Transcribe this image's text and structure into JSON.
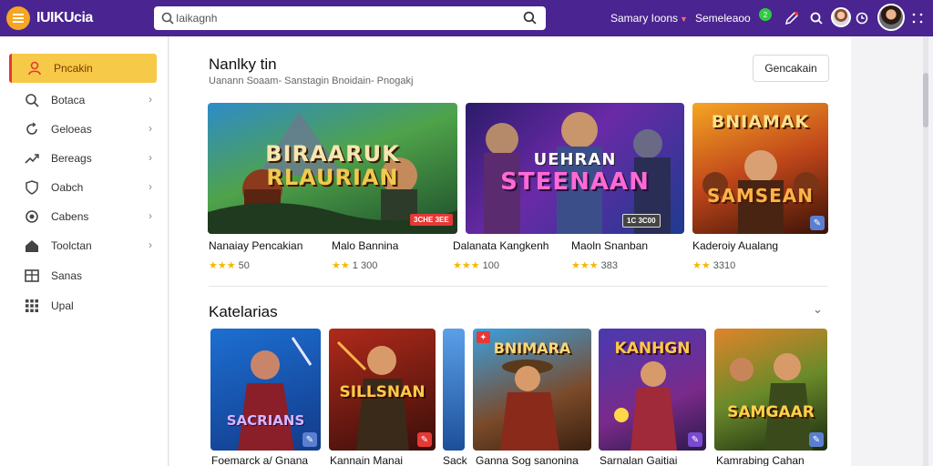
{
  "header": {
    "logo_text": "IUIKUciа",
    "search_value": "Iaikagnh",
    "link_1": "Samary Ioons",
    "link_2": "Semeleaoo",
    "notif_count": "2"
  },
  "sidebar": {
    "items": [
      {
        "label": "Pncakin",
        "icon": "user-icon",
        "active": true,
        "chevron": false
      },
      {
        "label": "Botaca",
        "icon": "search-icon",
        "active": false,
        "chevron": true
      },
      {
        "label": "Geloeas",
        "icon": "refresh-icon",
        "active": false,
        "chevron": true
      },
      {
        "label": "Bereags",
        "icon": "trend-icon",
        "active": false,
        "chevron": true
      },
      {
        "label": "Oabch",
        "icon": "shield-icon",
        "active": false,
        "chevron": true
      },
      {
        "label": "Cabens",
        "icon": "target-icon",
        "active": false,
        "chevron": true
      },
      {
        "label": "Toolctan",
        "icon": "home-icon",
        "active": false,
        "chevron": true
      },
      {
        "label": "Sanas",
        "icon": "grid-icon",
        "active": false,
        "chevron": false
      },
      {
        "label": "Upal",
        "icon": "apps-icon",
        "active": false,
        "chevron": false
      }
    ]
  },
  "main": {
    "section_title": "Nanlky tin",
    "section_subtitle": "Uanann Soaam- Sanstagin Bnoidain- Pnogakj",
    "action_button": "Gencakain",
    "featured": [
      {
        "art_title_1": "BIRAARUK",
        "art_title_2": "RLAURIAN",
        "tag": "3CHE 3EE"
      },
      {
        "art_title_1": "UEHRAN",
        "art_title_2": "STEENAAN",
        "tag": "1C 3C00"
      },
      {
        "art_title_1": "BNIAMAK",
        "art_title_2": "SAMSEAN"
      }
    ],
    "featured_captions": [
      {
        "title": "Nanaiay Pencakian",
        "rating": "50"
      },
      {
        "title": "Malo Bannina",
        "rating": "1 300"
      },
      {
        "title": "Dalanata Kangkenh",
        "rating": "100"
      },
      {
        "title": "Maoln Snanban",
        "rating": "383"
      },
      {
        "title": "Kaderoiy Aualang",
        "rating": "3310"
      }
    ],
    "categories_title": "Katelarias",
    "categories": [
      {
        "art_title": "SACRIANS",
        "caption": "Foemarck a/ Gnana"
      },
      {
        "art_title": "SILLSNAN",
        "caption": "Kannain Manai"
      },
      {
        "caption": "Sack"
      },
      {
        "art_title": "BNIMARA",
        "caption": "Ganna Sog sanonina"
      },
      {
        "art_title": "KANHGN",
        "caption": "Sarnalan Gaitiai"
      },
      {
        "art_title": "SAMGAAR",
        "caption": "Kamrabing Cahan"
      }
    ]
  },
  "colors": {
    "topbar": "#4a2490",
    "accent_yellow": "#f7c948",
    "accent_red": "#e53935",
    "star": "#f5b800"
  }
}
